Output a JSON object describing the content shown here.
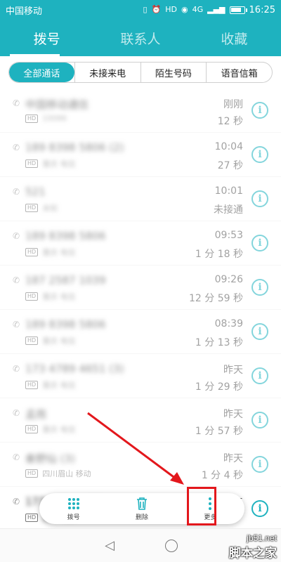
{
  "status_bar": {
    "carrier": "中国移动",
    "hd_badge": "HD",
    "network": "4G",
    "time": "16:25",
    "battery_level": 0.85
  },
  "tabs": [
    {
      "label": "拨号",
      "active": true
    },
    {
      "label": "联系人",
      "active": false
    },
    {
      "label": "收藏",
      "active": false
    }
  ],
  "filters": [
    {
      "label": "全部通话",
      "active": true
    },
    {
      "label": "未接来电",
      "active": false
    },
    {
      "label": "陌生号码",
      "active": false
    },
    {
      "label": "语音信箱",
      "active": false
    }
  ],
  "calls": [
    {
      "name": "中国移动通信",
      "detail": "10086",
      "time": "刚刚",
      "duration": "12 秒",
      "missed": false
    },
    {
      "name": "189 8398 5806 (2)",
      "detail": "重庆 电信",
      "time": "10:04",
      "duration": "27 秒",
      "missed": false
    },
    {
      "name": "521",
      "detail": "未知",
      "time": "10:01",
      "duration": "未接通",
      "missed": false
    },
    {
      "name": "189 8398 5806",
      "detail": "重庆 电信",
      "time": "09:53",
      "duration": "1 分 18 秒",
      "missed": false
    },
    {
      "name": "187 2587 1039",
      "detail": "重庆 电信",
      "time": "09:26",
      "duration": "12 分 59 秒",
      "missed": false
    },
    {
      "name": "189 8398 5806",
      "detail": "重庆 电信",
      "time": "08:39",
      "duration": "1 分 13 秒",
      "missed": false
    },
    {
      "name": "173 4789 4651 (3)",
      "detail": "重庆 电信",
      "time": "昨天",
      "duration": "1 分 29 秒",
      "missed": false
    },
    {
      "name": "孟雨",
      "detail": "重庆 电信",
      "time": "昨天",
      "duration": "1 分 57 秒",
      "missed": false
    },
    {
      "name": "秦野仙 (3)",
      "detail": "四川眉山 移动",
      "time": "昨天",
      "duration": "1 分 4 秒",
      "missed": false
    },
    {
      "name": "173 4789 4651",
      "detail": "重庆 电信",
      "time": "昨天",
      "duration": "",
      "missed": false
    }
  ],
  "toolbar": {
    "dial_label": "拨号",
    "delete_label": "删除",
    "more_label": "更多"
  },
  "watermark": {
    "line1": "jb51.net",
    "line2": "脚本之家"
  },
  "colors": {
    "accent": "#1eb2bf",
    "highlight": "#e3171c"
  }
}
